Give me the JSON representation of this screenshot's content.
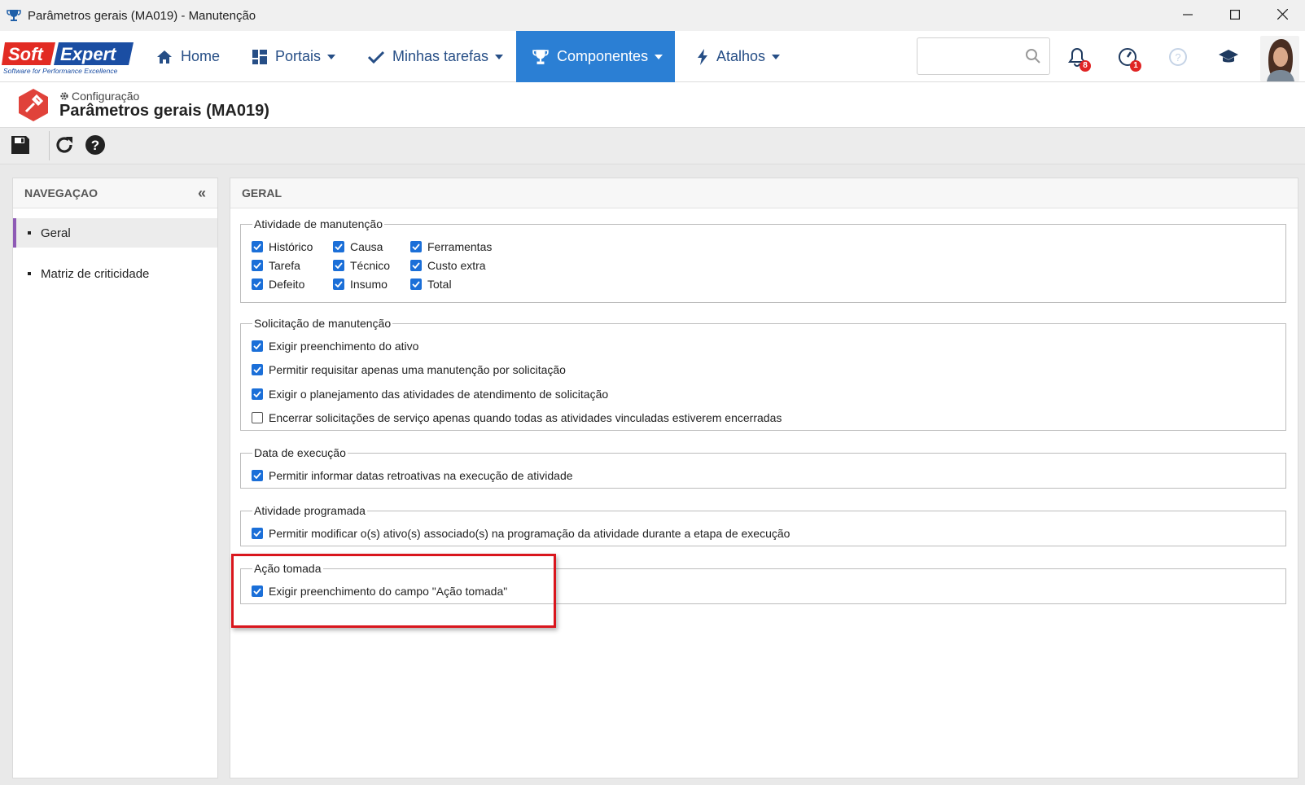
{
  "window": {
    "title": "Parâmetros gerais (MA019) - Manutenção",
    "app_icon": "trophy-icon",
    "controls": [
      "minimize-icon",
      "maximize-icon",
      "close-icon"
    ]
  },
  "topnav": {
    "logo_text": "SoftExpert",
    "logo_tagline": "Software for Performance Excellence",
    "items": [
      {
        "label": "Home",
        "icon": "home-icon"
      },
      {
        "label": "Portais",
        "icon": "grid-icon"
      },
      {
        "label": "Minhas tarefas",
        "icon": "check-icon"
      },
      {
        "label": "Componentes",
        "icon": "trophy-icon"
      },
      {
        "label": "Atalhos",
        "icon": "bolt-icon"
      }
    ],
    "search_placeholder": "",
    "notifications_count": "8",
    "tasks_count": "1"
  },
  "header": {
    "breadcrumb": "Configuração",
    "title": "Parâmetros gerais (MA019)"
  },
  "toolbar": {
    "buttons": [
      "save-icon",
      "refresh-icon",
      "help-icon"
    ]
  },
  "nav": {
    "heading": "NAVEGAÇAO",
    "items": [
      {
        "label": "Geral",
        "selected": true
      },
      {
        "label": "Matriz de criticidade",
        "selected": false
      }
    ]
  },
  "main": {
    "heading": "GERAL",
    "groups": {
      "atividade": {
        "legend": "Atividade de manutenção",
        "items": [
          {
            "label": "Histórico",
            "checked": true
          },
          {
            "label": "Tarefa",
            "checked": true
          },
          {
            "label": "Defeito",
            "checked": true
          },
          {
            "label": "Causa",
            "checked": true
          },
          {
            "label": "Técnico",
            "checked": true
          },
          {
            "label": "Insumo",
            "checked": true
          },
          {
            "label": "Ferramentas",
            "checked": true
          },
          {
            "label": "Custo extra",
            "checked": true
          },
          {
            "label": "Total",
            "checked": true
          }
        ]
      },
      "solicitacao": {
        "legend": "Solicitação de manutenção",
        "items": [
          {
            "label": "Exigir preenchimento do ativo",
            "checked": true
          },
          {
            "label": "Permitir requisitar apenas uma manutenção por solicitação",
            "checked": true
          },
          {
            "label": "Exigir o planejamento das atividades de atendimento de solicitação",
            "checked": true
          },
          {
            "label": "Encerrar solicitações de serviço apenas quando todas as atividades vinculadas estiverem encerradas",
            "checked": false
          }
        ]
      },
      "execucao": {
        "legend": "Data de execução",
        "items": [
          {
            "label": "Permitir informar datas retroativas na execução de atividade",
            "checked": true
          }
        ]
      },
      "programada": {
        "legend": "Atividade programada",
        "items": [
          {
            "label": "Permitir modificar o(s) ativo(s) associado(s) na programação da atividade durante a etapa de execução",
            "checked": true
          }
        ]
      },
      "acao": {
        "legend": "Ação tomada",
        "items": [
          {
            "label": "Exigir preenchimento do campo \"Ação tomada\"",
            "checked": true
          }
        ]
      }
    }
  },
  "colors": {
    "accent": "#2b7fd4",
    "nav_text": "#264e86",
    "checkbox": "#1b6fd8",
    "highlight": "#d9161d",
    "selected_bar": "#8e5ab5"
  }
}
